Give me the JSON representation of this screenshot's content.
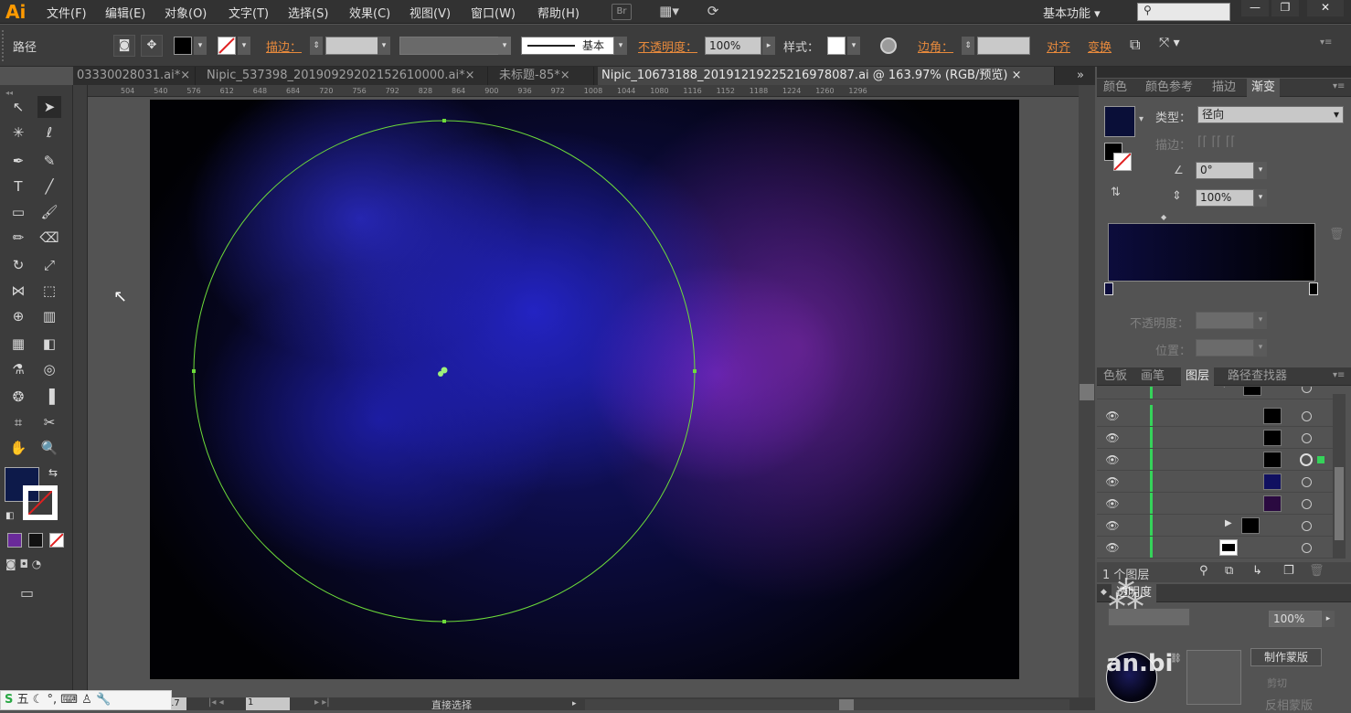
{
  "app": {
    "logo": "Ai"
  },
  "menu": [
    "文件(F)",
    "编辑(E)",
    "对象(O)",
    "文字(T)",
    "选择(S)",
    "效果(C)",
    "视图(V)",
    "窗口(W)",
    "帮助(H)"
  ],
  "menubar": {
    "bridge_label": "Br",
    "workspace": "基本功能",
    "search_placeholder": ""
  },
  "control_bar": {
    "selection_label": "路径",
    "stroke_label": "描边：",
    "stroke_style": "基本",
    "opacity_label": "不透明度：",
    "opacity_value": "100%",
    "style_label": "样式：",
    "corner_label": "边角：",
    "align_label": "对齐",
    "transform_label": "变换"
  },
  "tabs": [
    {
      "label": "03330028031.ai*",
      "close": "×",
      "active": false
    },
    {
      "label": "Nipic_537398_20190929202152610000.ai*",
      "close": "×",
      "active": false
    },
    {
      "label": "未标题-85*",
      "close": "×",
      "active": false
    },
    {
      "label": "Nipic_10673188_20191219225216978087.ai @ 163.97% (RGB/预览)",
      "close": "×",
      "active": true
    }
  ],
  "tabs_overflow": "»",
  "ruler_ticks": [
    "504",
    "540",
    "576",
    "612",
    "648",
    "684",
    "720",
    "756",
    "792",
    "828",
    "864",
    "900",
    "936",
    "972",
    "1008",
    "1044",
    "1080",
    "1116",
    "1152",
    "1188",
    "1224",
    "1260",
    "1296"
  ],
  "status_bar": {
    "zoom": "17",
    "page": "1",
    "tool_name": "直接选择"
  },
  "gradient_panel": {
    "tabs": [
      "颜色",
      "颜色参考",
      "描边",
      "渐变"
    ],
    "active_tab": "渐变",
    "type_label": "类型：",
    "type_value": "径向",
    "stroke_label": "描边：",
    "angle_value": "0°",
    "aspect_value": "100%",
    "opacity_label": "不透明度：",
    "position_label": "位置：",
    "stop_colors": [
      "#0c0c3c",
      "#000000"
    ]
  },
  "layers_panel": {
    "tabs": [
      "色板",
      "画笔",
      "图层",
      "路径查找器"
    ],
    "active_tab": "图层",
    "count_label": "1 个图层"
  },
  "transparency_panel": {
    "title": "透明度",
    "opacity_value": "100%",
    "make_mask_label": "制作蒙版",
    "clip_label": "剪切",
    "invert_label": "反相蒙版"
  },
  "watermark": {
    "text": "an.bi"
  },
  "colors": {
    "accent": "#ff9a00",
    "path_selection": "#6ddc3a",
    "fill": "#0d1a4a"
  }
}
